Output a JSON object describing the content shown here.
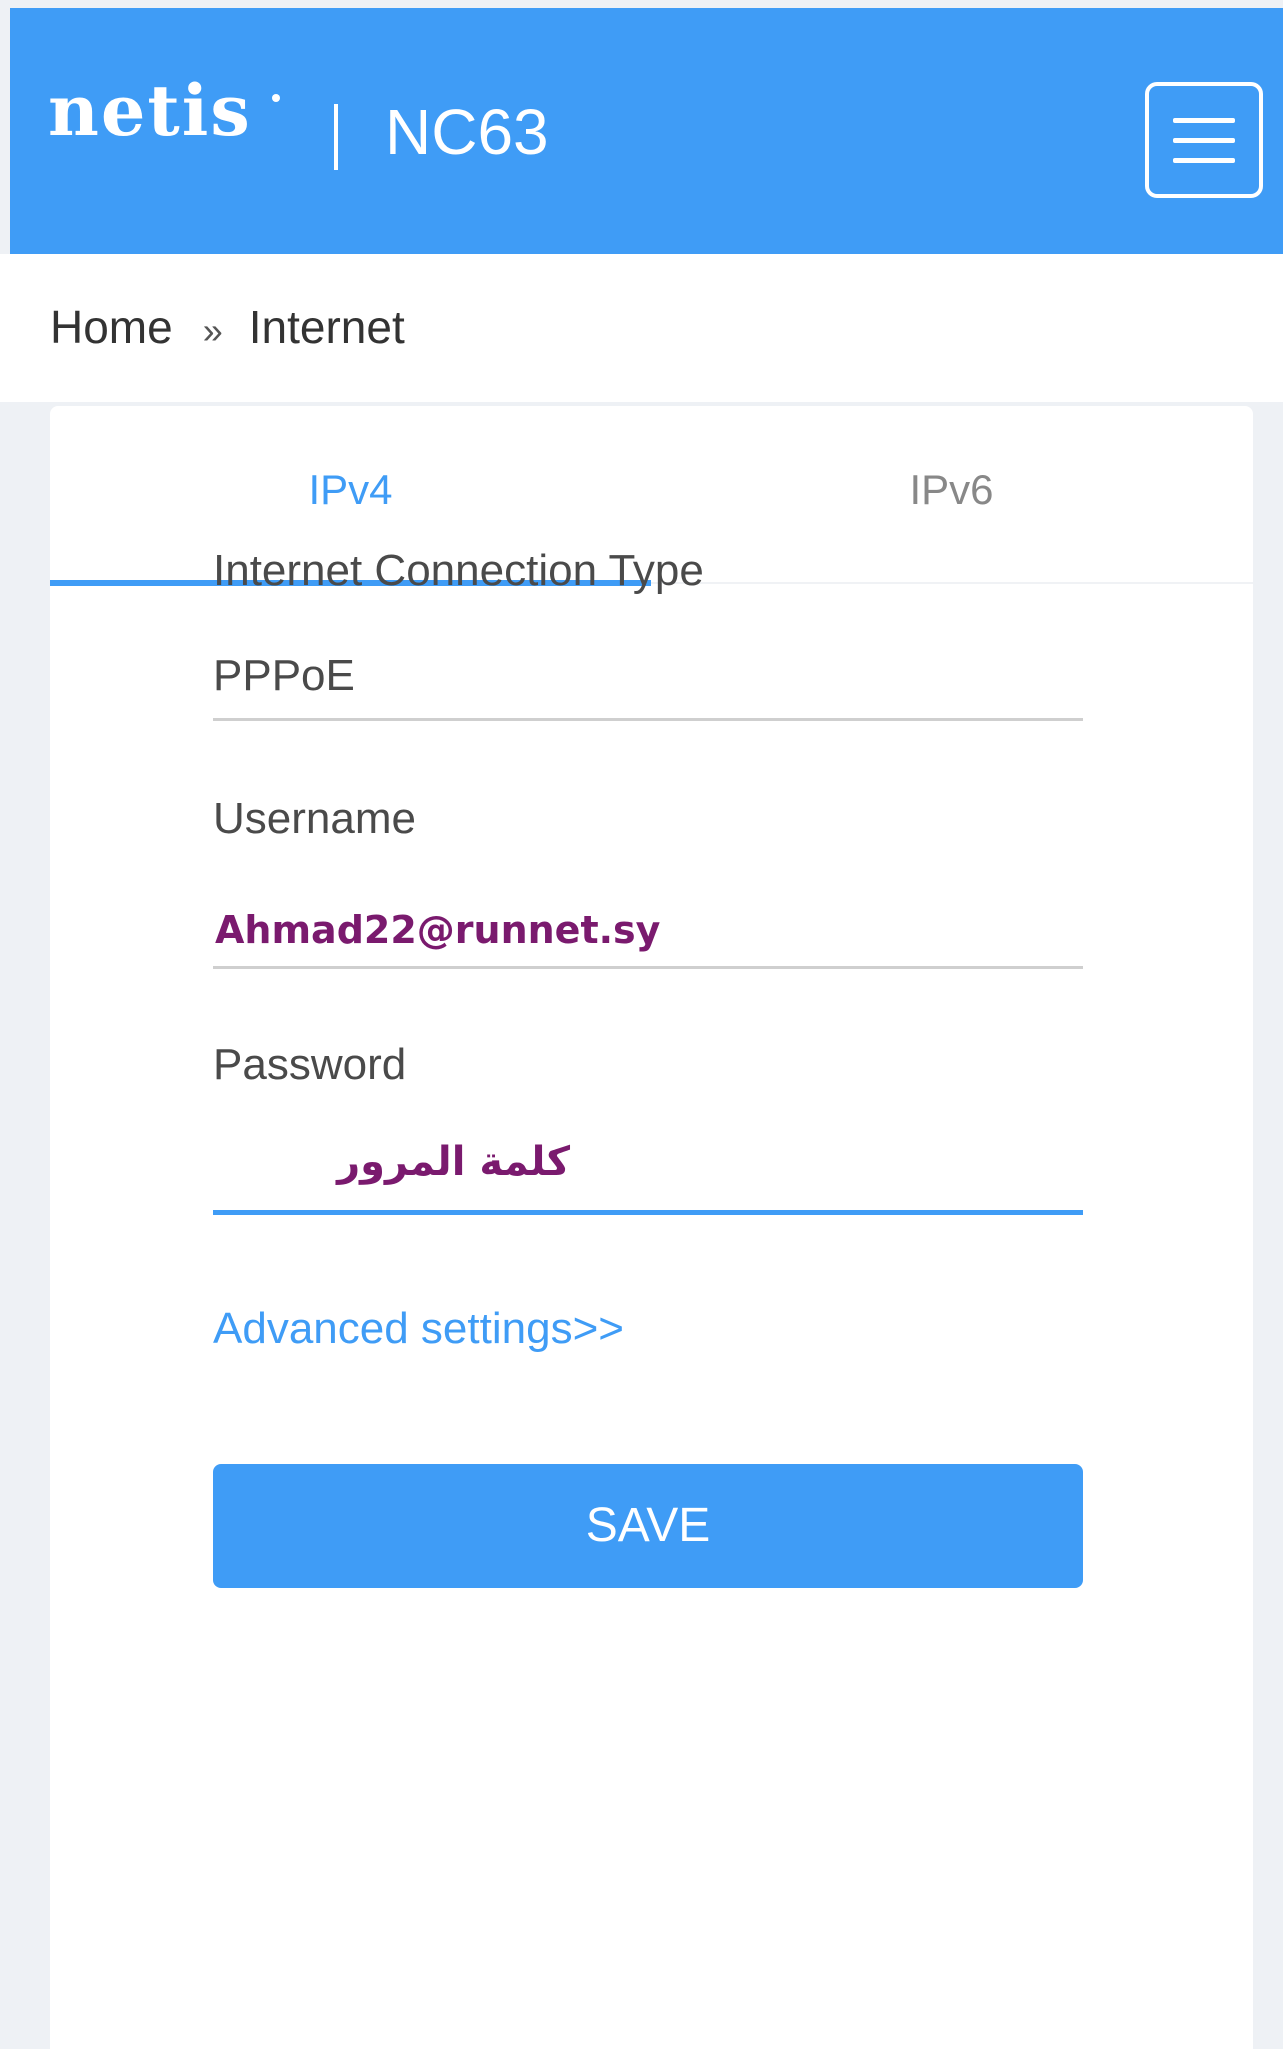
{
  "header": {
    "brand": "netis",
    "model": "NC63",
    "colors": {
      "header_bg": "#3f9cf6",
      "accent": "#3f9cf6",
      "annotation": "#7a1a6e"
    },
    "menu_icon": "hamburger-menu-icon"
  },
  "breadcrumb": {
    "items": [
      "Home",
      "Internet"
    ],
    "separator": "»"
  },
  "tabs": {
    "ipv4": "IPv4",
    "ipv6": "IPv6",
    "active": "IPv4"
  },
  "form": {
    "connection_type": {
      "label": "Internet Connection Type",
      "value": "PPPoE"
    },
    "username": {
      "label": "Username",
      "value": "Ahmad22@runnet.sy"
    },
    "password": {
      "label": "Password",
      "value": "كلمة المرور"
    },
    "advanced_link": "Advanced settings>>",
    "save_label": "SAVE"
  }
}
